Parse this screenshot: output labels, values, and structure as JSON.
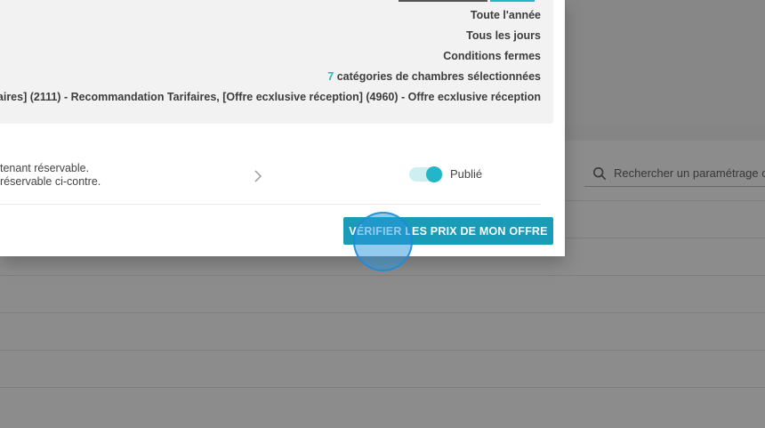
{
  "background": {
    "search": {
      "placeholder": "Rechercher un paramétrage c"
    }
  },
  "summary": {
    "period": "Toute l'année",
    "days": "Tous les jours",
    "conditions": "Conditions fermes",
    "room_categories": {
      "count": "7",
      "text": " catégories de chambres sélectionnées"
    },
    "rates": "aires] (2111) - Recommandation Tarifaires, [Offre ecxlusive réception] (4960) - Offre ecxlusive réception"
  },
  "status": {
    "line1": "tenant réservable.",
    "line2": " réservable ci-contre.",
    "toggle_label": "Publié",
    "published": true
  },
  "actions": {
    "verify_label": "VÉRIFIER LES PRIX DE MON OFFRE"
  },
  "colors": {
    "accent": "#1fb8c6",
    "button": "#1a9bb8"
  }
}
